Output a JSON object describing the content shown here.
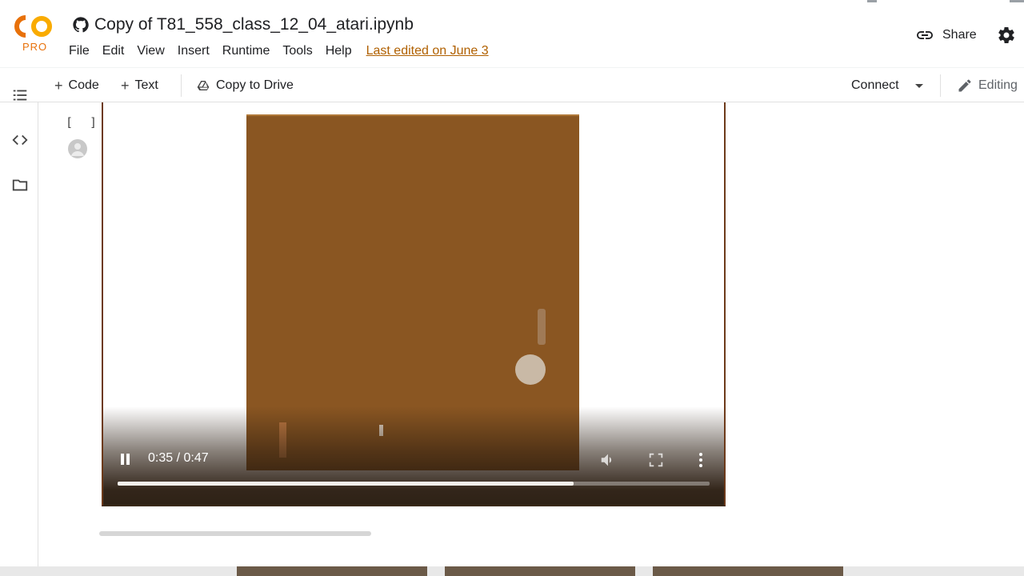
{
  "header": {
    "logo": {
      "mark": "CO",
      "badge": "PRO"
    },
    "notebook_title": "Copy of T81_558_class_12_04_atari.ipynb",
    "menu": [
      "File",
      "Edit",
      "View",
      "Insert",
      "Runtime",
      "Tools",
      "Help"
    ],
    "last_edited": "Last edited on June 3",
    "share_label": "Share"
  },
  "toolbar": {
    "code_label": "Code",
    "text_label": "Text",
    "copy_to_drive_label": "Copy to Drive",
    "connect_label": "Connect",
    "editing_label": "Editing"
  },
  "cell": {
    "run_brackets": "[ ]"
  },
  "video": {
    "time_display": "0:35 / 0:47",
    "progress": 0.77
  },
  "colors": {
    "game_background": "#8a5622",
    "accent_orange": "#e8710a",
    "link_brown": "#b06000"
  },
  "icons": {
    "github": "github-icon",
    "share": "link-icon",
    "settings": "gear-icon",
    "drive": "drive-icon",
    "editing": "pencil-icon",
    "toc": "list-icon",
    "snippets": "code-icon",
    "files": "folder-icon"
  }
}
